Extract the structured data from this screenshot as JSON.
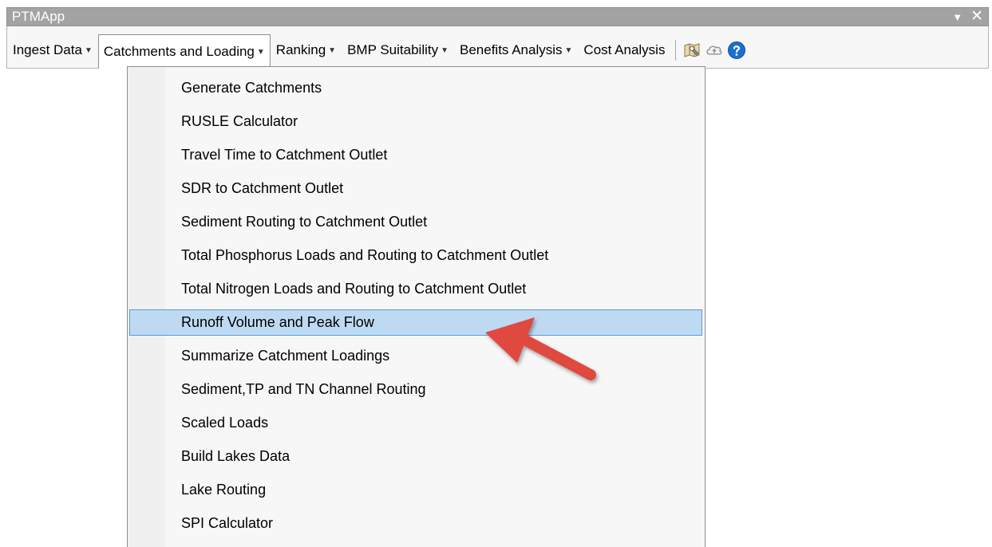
{
  "app": {
    "title": "PTMApp"
  },
  "window_controls": {
    "pin": "▼",
    "close": "✕"
  },
  "menu": [
    {
      "label": "Ingest Data",
      "has_dropdown": true
    },
    {
      "label": "Catchments and Loading",
      "has_dropdown": true,
      "active": true
    },
    {
      "label": "Ranking",
      "has_dropdown": true
    },
    {
      "label": "BMP Suitability",
      "has_dropdown": true
    },
    {
      "label": "Benefits Analysis",
      "has_dropdown": true
    },
    {
      "label": "Cost Analysis",
      "has_dropdown": false
    }
  ],
  "toolbar_icons": [
    "map-tools-icon",
    "cloud-icon",
    "help-icon"
  ],
  "dropdown": {
    "items": [
      "Generate Catchments",
      "RUSLE Calculator",
      "Travel Time to Catchment Outlet",
      "SDR to Catchment Outlet",
      "Sediment Routing to Catchment Outlet",
      "Total Phosphorus Loads and Routing to Catchment Outlet",
      "Total Nitrogen Loads and Routing to Catchment Outlet",
      "Runoff Volume and Peak Flow",
      "Summarize Catchment Loadings",
      "Sediment,TP and TN Channel Routing",
      "Scaled Loads",
      "Build Lakes Data",
      "Lake Routing",
      "SPI Calculator"
    ],
    "highlighted_index": 7
  },
  "colors": {
    "highlight_bg": "#bedaf3",
    "highlight_border": "#5b9bd5",
    "annotation_arrow": "#e04a3f",
    "help_blue": "#1a6fd1"
  }
}
